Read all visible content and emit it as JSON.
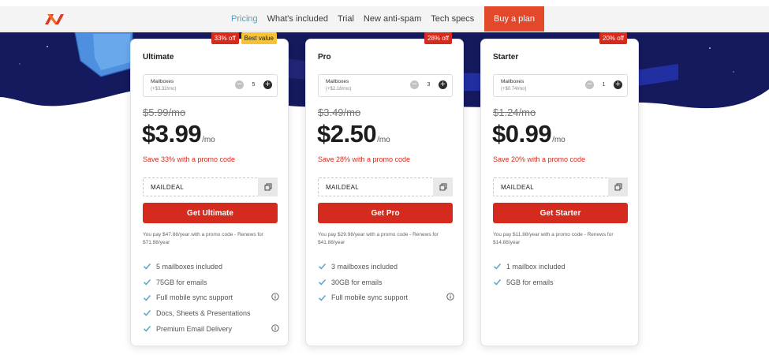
{
  "nav": {
    "logo": "namecheap-logo",
    "links": [
      {
        "label": "Pricing",
        "active": true
      },
      {
        "label": "What's included",
        "active": false
      },
      {
        "label": "Trial",
        "active": false
      },
      {
        "label": "New anti-spam",
        "active": false
      },
      {
        "label": "Tech specs",
        "active": false
      }
    ],
    "buy_label": "Buy a plan"
  },
  "colors": {
    "accent_red": "#d52b1e",
    "nav_active": "#4da1c9",
    "best_value": "#f7c233",
    "hero_navy": "#15195e",
    "check": "#5fa9c8"
  },
  "plans": [
    {
      "name": "Ultimate",
      "badges": {
        "off": "33% off",
        "best": "Best value"
      },
      "mailboxes": {
        "label": "Mailboxes",
        "sub": "(+$3.32/mo)",
        "value": "5"
      },
      "old_price": "$5.99/mo",
      "price": "$3.99",
      "per": "/mo",
      "save": "Save 33% with a promo code",
      "promo": "MAILDEAL",
      "cta": "Get Ultimate",
      "pay_note": "You pay $47.88/year with a promo code - Renews for $71.88/year",
      "features": [
        {
          "text": "5 mailboxes included",
          "info": false
        },
        {
          "text": "75GB for emails",
          "info": false
        },
        {
          "text": "Full mobile sync support",
          "info": true
        },
        {
          "text": "Docs, Sheets & Presentations",
          "info": false
        },
        {
          "text": "Premium Email Delivery",
          "info": true
        }
      ]
    },
    {
      "name": "Pro",
      "badges": {
        "off": "28% off"
      },
      "mailboxes": {
        "label": "Mailboxes",
        "sub": "(+$2.16/mo)",
        "value": "3"
      },
      "old_price": "$3.49/mo",
      "price": "$2.50",
      "per": "/mo",
      "save": "Save 28% with a promo code",
      "promo": "MAILDEAL",
      "cta": "Get Pro",
      "pay_note": "You pay $29.98/year with a promo code - Renews for $41.88/year",
      "features": [
        {
          "text": "3 mailboxes included",
          "info": false
        },
        {
          "text": "30GB for emails",
          "info": false
        },
        {
          "text": "Full mobile sync support",
          "info": true
        }
      ]
    },
    {
      "name": "Starter",
      "badges": {
        "off": "20% off"
      },
      "mailboxes": {
        "label": "Mailboxes",
        "sub": "(+$0.74/mo)",
        "value": "1"
      },
      "old_price": "$1.24/mo",
      "price": "$0.99",
      "per": "/mo",
      "save": "Save 20% with a promo code",
      "promo": "MAILDEAL",
      "cta": "Get Starter",
      "pay_note": "You pay $11.88/year with a promo code - Renews for $14.88/year",
      "features": [
        {
          "text": "1 mailbox included",
          "info": false
        },
        {
          "text": "5GB for emails",
          "info": false
        }
      ]
    }
  ]
}
